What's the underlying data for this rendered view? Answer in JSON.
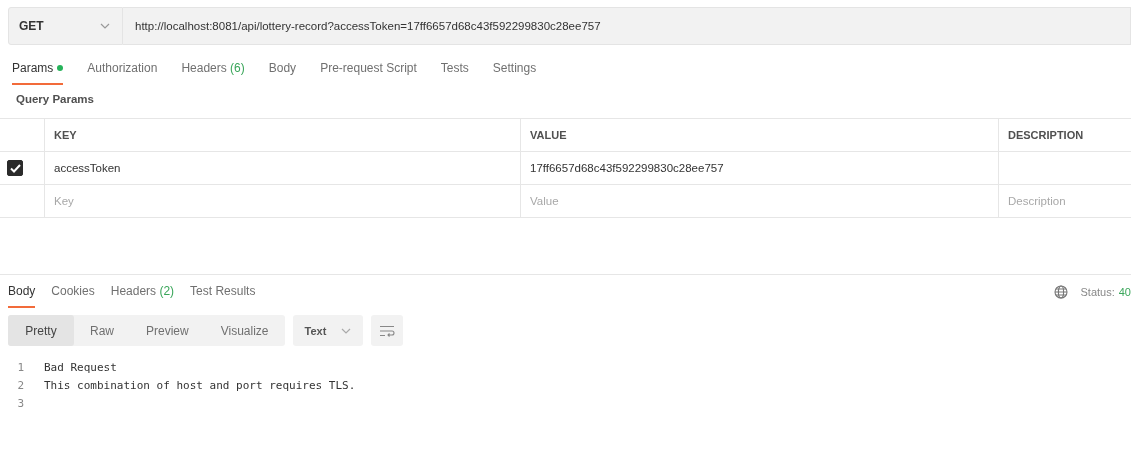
{
  "request": {
    "method": "GET",
    "url": "http://localhost:8081/api/lottery-record?accessToken=17ff6657d68c43f592299830c28ee757"
  },
  "request_tabs": [
    {
      "label": "Params",
      "selected": true,
      "dot": true
    },
    {
      "label": "Authorization",
      "selected": false,
      "dot": false
    },
    {
      "label": "Headers",
      "count": "(6)",
      "selected": false,
      "dot": false
    },
    {
      "label": "Body",
      "selected": false,
      "dot": false
    },
    {
      "label": "Pre-request Script",
      "selected": false,
      "dot": false
    },
    {
      "label": "Tests",
      "selected": false,
      "dot": false
    },
    {
      "label": "Settings",
      "selected": false,
      "dot": false
    }
  ],
  "section_title": "Query Params",
  "params_table": {
    "columns": [
      "KEY",
      "VALUE",
      "DESCRIPTION"
    ],
    "rows": [
      {
        "checked": true,
        "key": "accessToken",
        "value": "17ff6657d68c43f592299830c28ee757"
      }
    ],
    "new_row": {
      "key": {
        "placeholder": "Key"
      },
      "value": {
        "placeholder": "Value"
      },
      "description": {
        "placeholder": "Description"
      }
    }
  },
  "response_tabs": [
    {
      "label": "Body",
      "selected": true
    },
    {
      "label": "Cookies",
      "selected": false
    },
    {
      "label": "Headers",
      "count": "(2)",
      "selected": false
    },
    {
      "label": "Test Results",
      "selected": false
    }
  ],
  "status": {
    "label": "Status:",
    "value": "40"
  },
  "view_modes": [
    {
      "label": "Pretty",
      "selected": true
    },
    {
      "label": "Raw",
      "selected": false
    },
    {
      "label": "Preview",
      "selected": false
    },
    {
      "label": "Visualize",
      "selected": false
    }
  ],
  "format": "Text",
  "code_lines": [
    {
      "number": "1",
      "text": "Bad Request"
    },
    {
      "number": "2",
      "text": "This combination of host and port requires TLS."
    },
    {
      "number": "3"
    }
  ]
}
